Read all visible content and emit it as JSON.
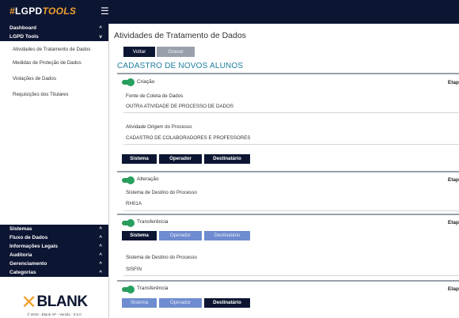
{
  "topbar": {
    "logo_hash": "#",
    "logo_part1": "LGPD",
    "logo_part2": "TOOLS",
    "menu_icon": "☰"
  },
  "sidebar": {
    "top_items": [
      {
        "label": "Dashboard",
        "chevron": "^"
      },
      {
        "label": "LGPD Tools",
        "chevron": "v"
      }
    ],
    "sub_items": [
      "Atividades de Tratamento de Dados",
      "Medidas de Proteção de Dados",
      "Violações de Dados",
      "Requisições dos Titulares"
    ],
    "bottom_items": [
      {
        "label": "Sistemas",
        "chevron": "^"
      },
      {
        "label": "Fluxo de Dados",
        "chevron": "^"
      },
      {
        "label": "Informações Legais",
        "chevron": "^"
      },
      {
        "label": "Auditoria",
        "chevron": "^"
      },
      {
        "label": "Gerenciamento",
        "chevron": "^"
      },
      {
        "label": "Categorias",
        "chevron": "^"
      }
    ],
    "brand": {
      "mark": "✕",
      "text": "BLANK",
      "version": "© 2019 - Blank AP - Versão : 0.5.0"
    }
  },
  "main": {
    "page_title": "Atividades de Tratamento de Dados",
    "voltar_label": "Voltar",
    "gravar_label": "Gravar",
    "section_title": "CADASTRO DE NOVOS ALUNOS",
    "etapa_label": "Etap",
    "blocks": [
      {
        "toggle_label": "Criação",
        "field1_label": "Fonte de Coleta de Dados",
        "field1_value": "OUTRA ATIVIDADE DE PROCESSO DE DADOS",
        "field2_label": "Atividade Origem do Processo",
        "field2_value": "CADASTRO DE COLABORADORES E PROFESSORES"
      },
      {
        "toggle_label": "Alteração",
        "field1_label": "Sistema de Destino do Processo",
        "field1_value": "RH01A"
      },
      {
        "toggle_label": "Transferência",
        "field1_label": "Sistema de Destino do Processo",
        "field1_value": "SISFIN"
      },
      {
        "toggle_label": "Transferência"
      }
    ],
    "buttons": {
      "sistema": "Sistema",
      "operador": "Operador",
      "destinatario": "Destinatário"
    }
  },
  "colors": {
    "navy": "#0c1532",
    "orange": "#f0a030",
    "teal_title": "#1f7f9e",
    "toggle_green": "#27a05f",
    "light_button": "#6e8ccf"
  }
}
